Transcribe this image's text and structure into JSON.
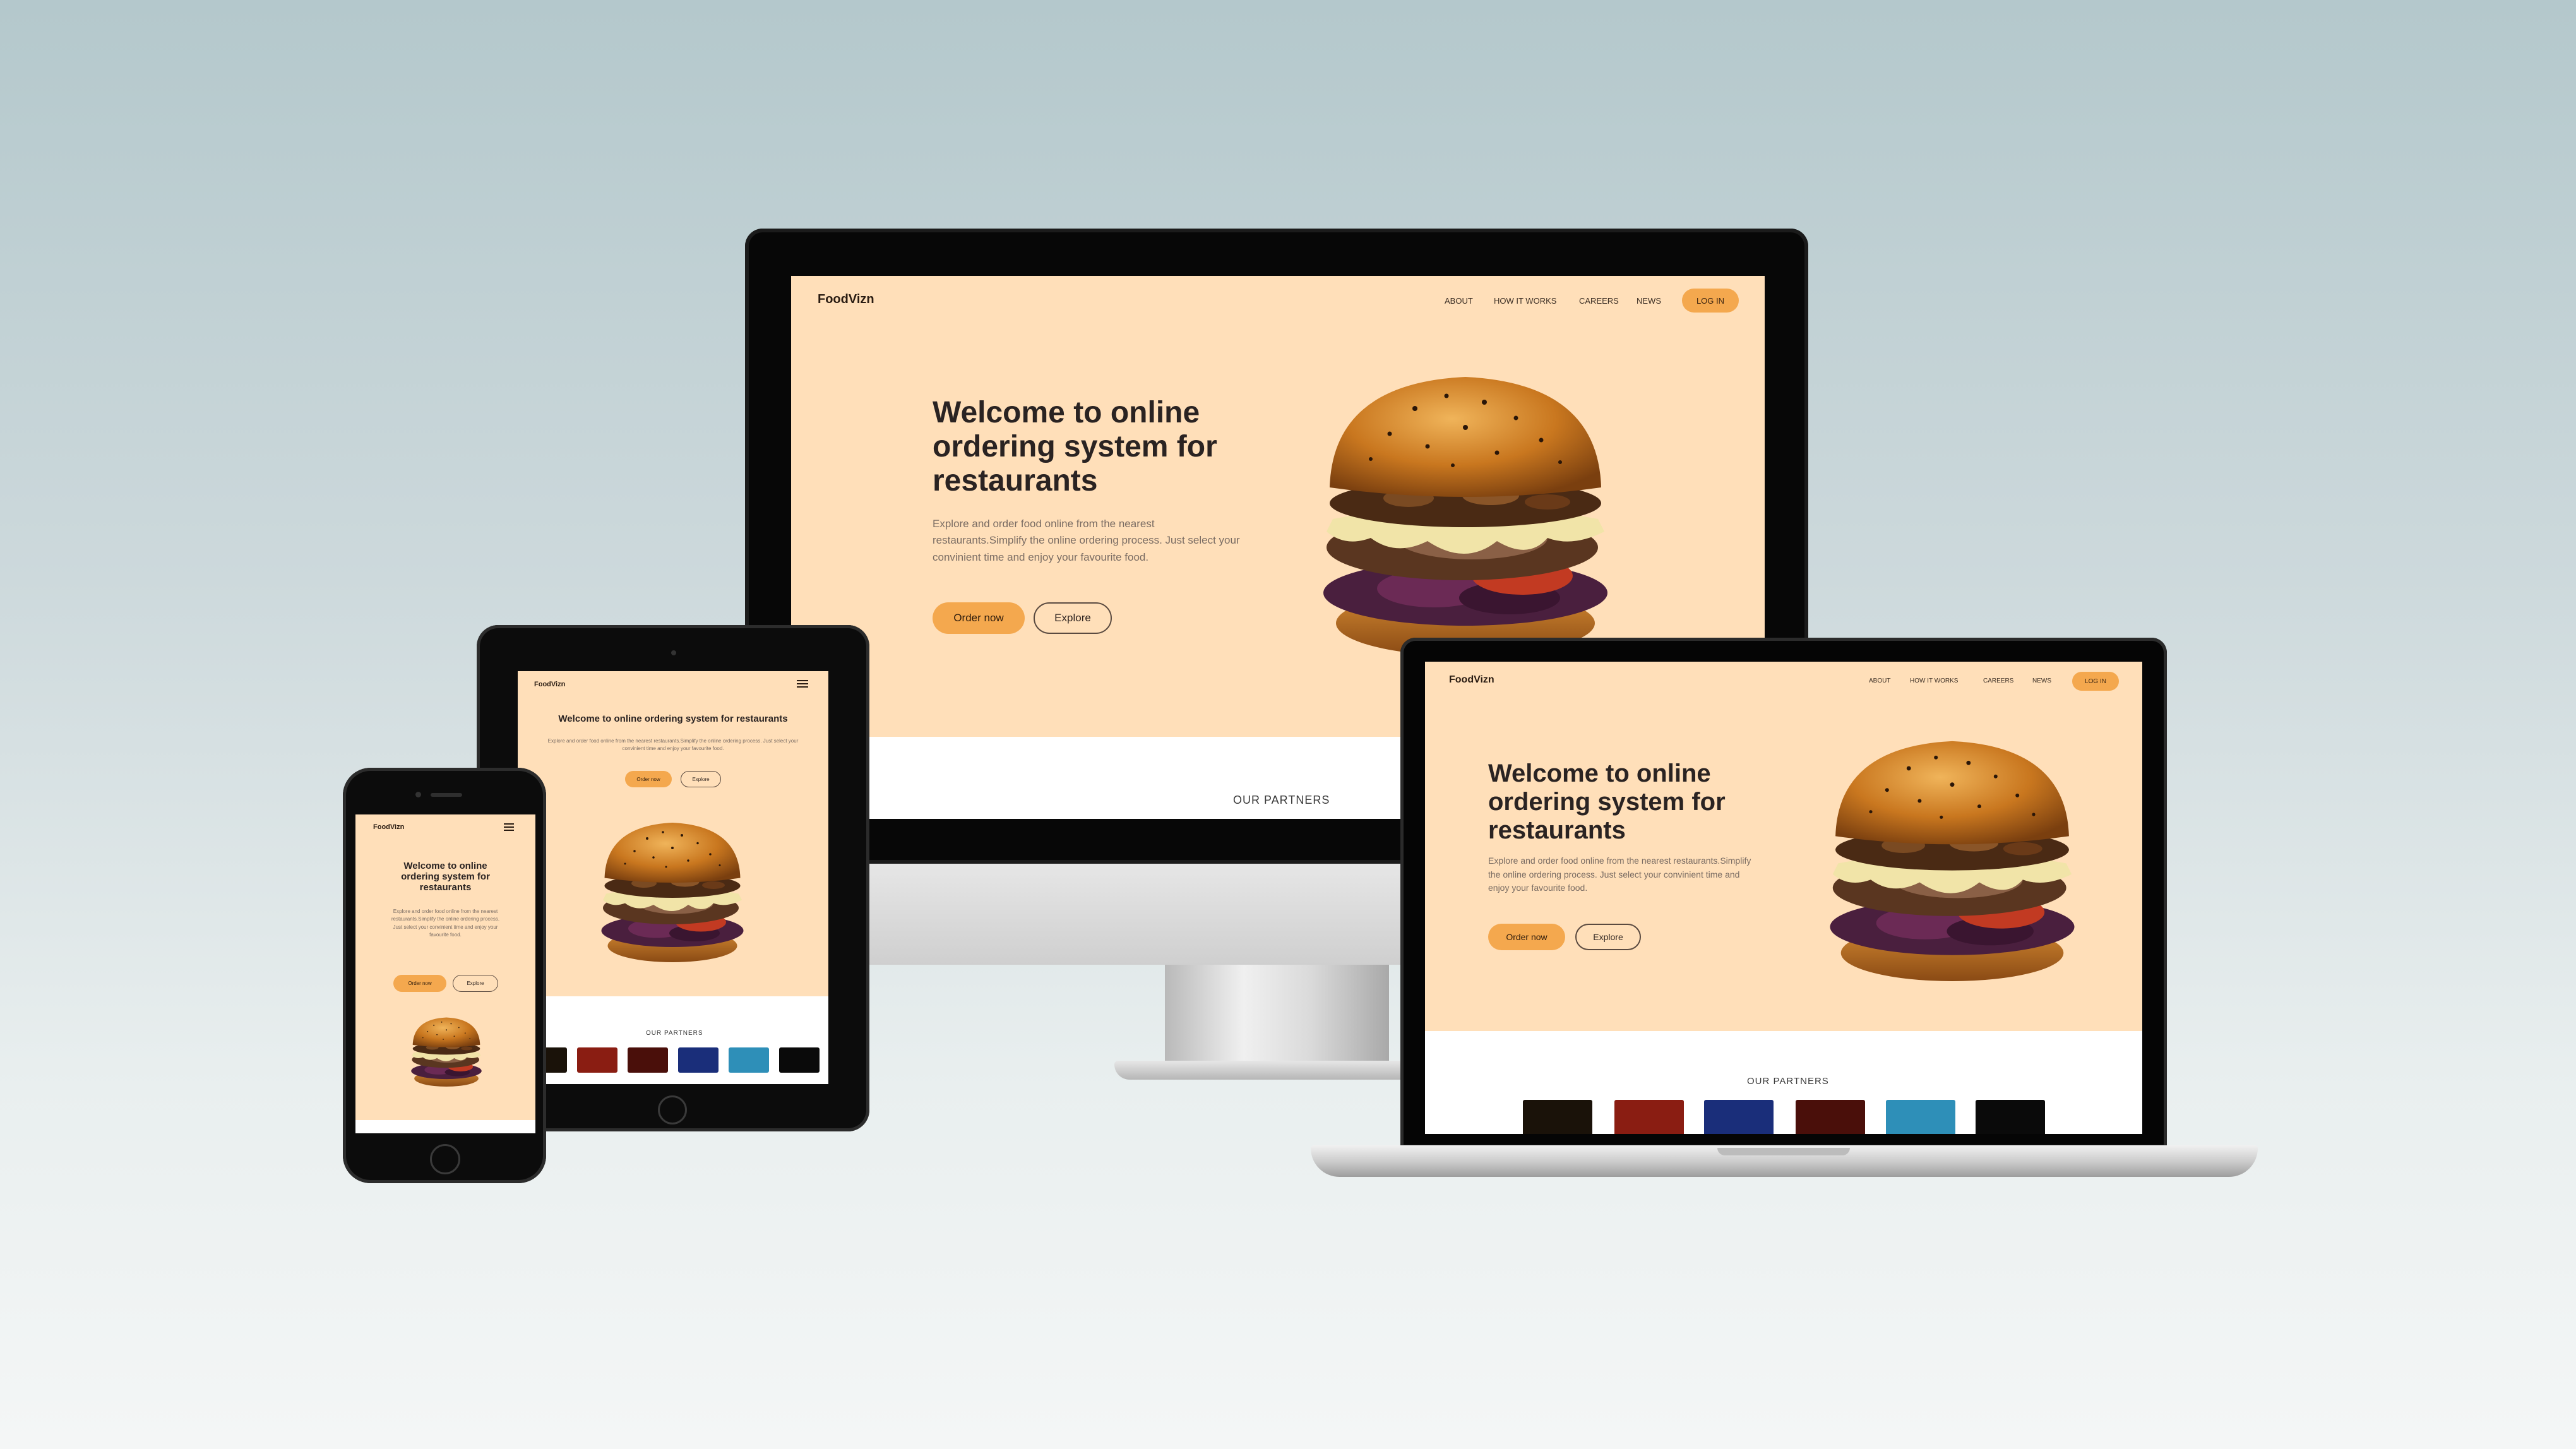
{
  "site": {
    "brand": "FoodVizn",
    "nav": {
      "about": "ABOUT",
      "how": "HOW IT WORKS",
      "careers": "CAREERS",
      "news": "NEWS",
      "login": "LOG IN"
    },
    "hero_title": "Welcome to online ordering system for restaurants",
    "hero_description": "Explore and order food online from the nearest restaurants.Simplify the online ordering process. Just select your convinient time and enjoy your favourite food.",
    "order_button": "Order now",
    "explore_button": "Explore",
    "partners_title": "OUR PARTNERS"
  },
  "colors": {
    "hero_bg": "#ffdfb9",
    "accent": "#f4a84e",
    "partner_tiles": [
      "#1a1209",
      "#8a1d12",
      "#1a2e7a",
      "#4a0f0a",
      "#2e8fb8",
      "#0a0a0a"
    ]
  },
  "icons": {
    "menu": "hamburger-menu-icon",
    "burger": "burger-image"
  }
}
